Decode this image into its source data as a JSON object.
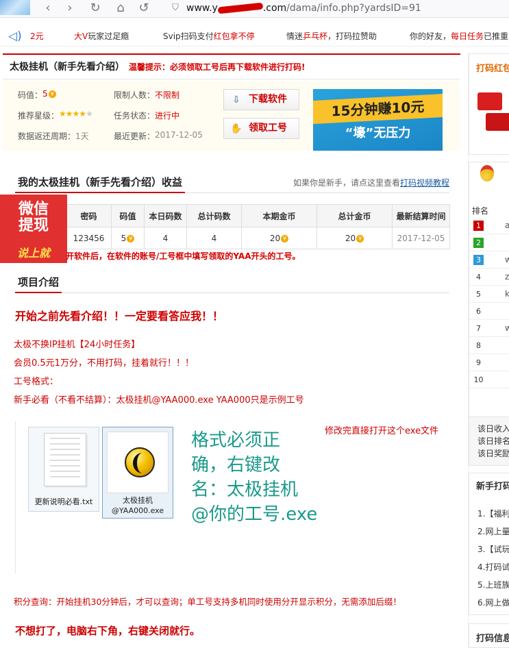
{
  "browser": {
    "back": "‹",
    "forward": "›",
    "reload": "↻",
    "home": "⌂",
    "undo": "↺",
    "url_host": "www.y",
    "url_host_tail": ".com",
    "url_path": "/dama/info.php?yardsID=91"
  },
  "marquee": {
    "speaker_icon": "speaker-icon",
    "m1_red": "2元",
    "m2_a": "大V",
    "m2_b": "玩家过足瘾",
    "m3_a": "Svip扫码支付",
    "m3_b": "红包拿不停",
    "m4_a": "情迷",
    "m4_b": "乒乓杯",
    "m4_c": "，打码拉赞助",
    "m5_a": "你的好友，",
    "m5_b": "每日任务",
    "m5_c": "已推重"
  },
  "project": {
    "title": "太极挂机（新手先看介绍）",
    "warm_tip": "温馨提示：必须领取工号后再下载软件进行打码!",
    "k_code_value": "码值：",
    "v_code_value": "5",
    "k_limit": "限制人数：",
    "v_limit": "不限制",
    "k_stars": "推荐星级：",
    "stars": 4,
    "stars_max": 5,
    "k_status": "任务状态：",
    "v_status": "进行中",
    "k_cycle": "数据返还周期：",
    "v_cycle": "1天",
    "k_update": "最近更新：",
    "v_update": "2017-12-05",
    "download_btn": "下载软件",
    "get_id_btn": "领取工号",
    "promo_l1": "15分钟赚10元",
    "promo_l2": "“壕”无压力"
  },
  "earnings": {
    "title": "我的太极挂机（新手先看介绍）收益",
    "help_pre": "如果你是新手，请点这里查看",
    "help_link": "打码视频教程",
    "headers": [
      "密码",
      "码值",
      "本日码数",
      "总计码数",
      "本期金币",
      "总计金币",
      "最新结算时间"
    ],
    "row": [
      "123456",
      "5",
      "4",
      "4",
      "20",
      "20",
      "2017-12-05"
    ],
    "notice": "开软件后，在软件的账号/工号框中填写领取的YAA开头的工号。"
  },
  "wechat_badge": {
    "l1": "微信",
    "l2": "提现",
    "l3": "说上就"
  },
  "intro": {
    "title": "项目介绍",
    "p1": "开始之前先看介绍！！一定要看答应我！！",
    "p2": "太极不换IP挂机【24小时任务】",
    "p3": "会员0.5元1万分，不用打码，挂着就行！！！",
    "p4": "工号格式：",
    "p5": "新手必看（不看不结算）：太极挂机@YAA000.exe     YAA000只是示例工号",
    "p6": "修改完直接打开这个exe文件",
    "file1": "更新说明必看.txt",
    "file2_l1": "太极挂机",
    "file2_l2": "@YAA000.exe",
    "big1": "格式必须正",
    "big2": "确，右键改",
    "big3": "名：太极挂机",
    "big4": "@你的工号.exe",
    "p7": "积分查询：开始挂机30分钟后，才可以查询；单工号支持多机同时使用分开显示积分，无需添加后缀！",
    "p8": "不想打了，电脑右下角，右键关闭就行。"
  },
  "sidebar": {
    "hb_title": "打码红包",
    "rank_header": "排名",
    "ranks": [
      "1",
      "2",
      "3",
      "4",
      "5",
      "6",
      "7",
      "8",
      "9",
      "10"
    ],
    "rank_tail": [
      "a",
      "",
      "w",
      "z",
      "k",
      "",
      "w",
      "",
      "",
      ""
    ],
    "income1": "该日收入",
    "income2": "该日排名",
    "income3": "该日奖励",
    "newbie_title": "新手打码",
    "newbie_items": [
      "1.【福利",
      "2.网上量",
      "3.【试玩",
      "4.打码试",
      "5.上班族",
      "6.网上做"
    ],
    "bottom_title": "打码信息"
  }
}
